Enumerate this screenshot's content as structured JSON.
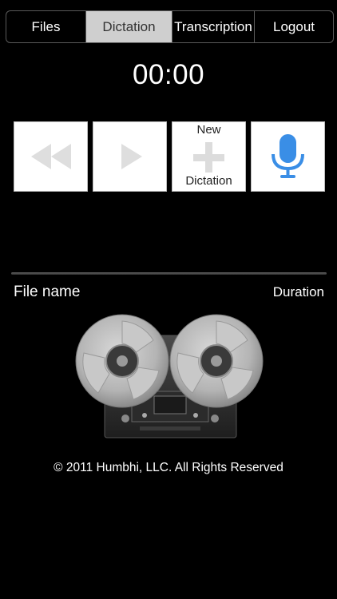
{
  "nav": {
    "tabs": [
      {
        "label": "Files"
      },
      {
        "label": "Dictation"
      },
      {
        "label": "Transcription"
      },
      {
        "label": "Logout"
      }
    ]
  },
  "timer": "00:00",
  "controls": {
    "new_top": "New",
    "new_bottom": "Dictation"
  },
  "file_list": {
    "name_header": "File name",
    "duration_header": "Duration"
  },
  "footer": "© 2011 Humbhi, LLC. All Rights Reserved",
  "colors": {
    "active_tab_bg": "#cfcfcf",
    "mic_blue": "#3a8ee6",
    "disabled_icon": "#dcdcdc"
  },
  "icons": [
    "rewind-icon",
    "play-icon",
    "plus-icon",
    "microphone-icon",
    "reel-to-reel-recorder"
  ]
}
